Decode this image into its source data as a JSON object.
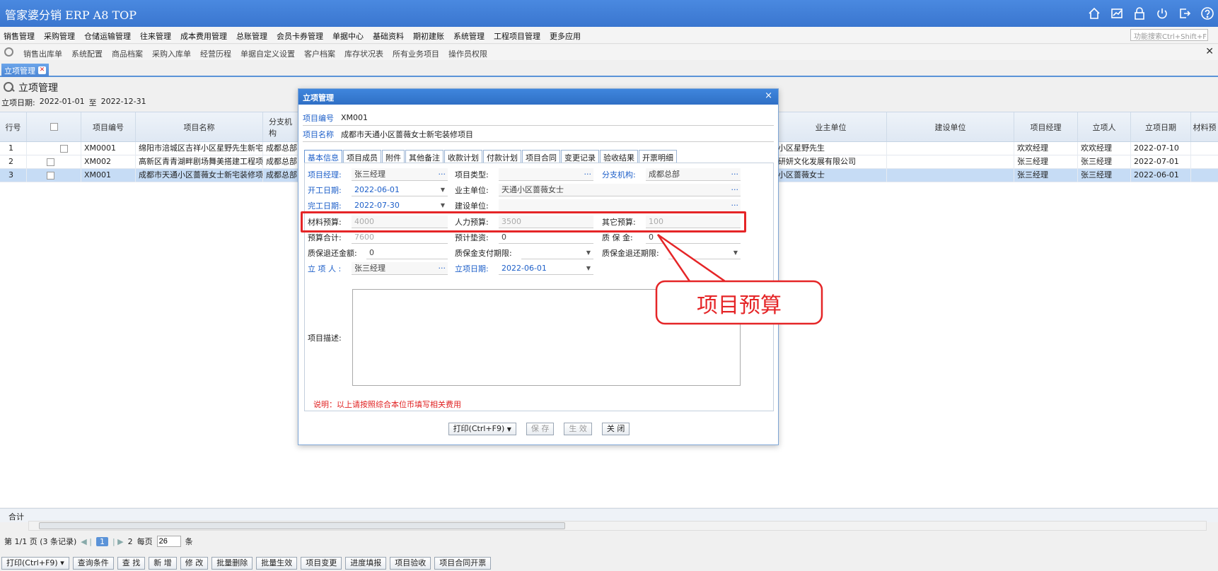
{
  "app": {
    "title": "管家婆分销 ERP A8 TOP"
  },
  "titlebar_icons": [
    "home-icon",
    "chart-icon",
    "lock-icon",
    "power-icon",
    "exit-icon",
    "help-icon"
  ],
  "menu": [
    "销售管理",
    "采购管理",
    "仓储运输管理",
    "往来管理",
    "成本费用管理",
    "总账管理",
    "会员卡券管理",
    "单据中心",
    "基础资料",
    "期初建账",
    "系统管理",
    "工程项目管理",
    "更多应用"
  ],
  "menu_search_placeholder": "功能搜索Ctrl+Shift+F",
  "quickbar": [
    "销售出库单",
    "系统配置",
    "商品档案",
    "采购入库单",
    "经营历程",
    "单据自定义设置",
    "客户档案",
    "库存状况表",
    "所有业务项目",
    "操作员权限"
  ],
  "tab": {
    "label": "立项管理"
  },
  "page": {
    "title": "立项管理",
    "date_label": "立项日期:",
    "date_from": "2022-01-01",
    "date_to_word": "至",
    "date_to": "2022-12-31"
  },
  "grid": {
    "headers": {
      "rowno": "行号",
      "code": "项目编号",
      "name": "项目名称",
      "branch": "分支机构",
      "owner": "业主单位",
      "builder": "建设单位",
      "manager": "项目经理",
      "creator": "立项人",
      "date": "立项日期",
      "material": "材料预"
    },
    "rows": [
      {
        "rowno": "1",
        "code": "XM0001",
        "name": "绵阳市涪城区吉祥小区星野先生新宅装修项目",
        "branch": "成都总部",
        "owner": "小区星野先生",
        "builder": "",
        "manager": "欢欢经理",
        "creator": "欢欢经理",
        "date": "2022-07-10"
      },
      {
        "rowno": "2",
        "code": "XM002",
        "name": "高新区青青湖畔剧场舞美搭建工程项目",
        "branch": "成都总部",
        "owner": "研妍文化发展有限公司",
        "builder": "",
        "manager": "张三经理",
        "creator": "张三经理",
        "date": "2022-07-01"
      },
      {
        "rowno": "3",
        "code": "XM001",
        "name": "成都市天通小区蔷薇女士新宅装修项目",
        "branch": "成都总部",
        "owner": "小区蔷薇女士",
        "builder": "",
        "manager": "张三经理",
        "creator": "张三经理",
        "date": "2022-06-01"
      }
    ],
    "footer_sum": "合计"
  },
  "pager": {
    "info": "第 1/1 页 (3 条记录)",
    "current": "1",
    "next_page": "2",
    "per_page_label": "每页",
    "per_page": "26",
    "unit": "条"
  },
  "bottom_buttons": [
    "打印(Ctrl+F9) ▾",
    "查询条件",
    "查 找",
    "新 增",
    "修 改",
    "批量删除",
    "批量生效",
    "项目变更",
    "进度填报",
    "项目验收",
    "项目合同开票"
  ],
  "dialog": {
    "title": "立项管理",
    "code_label": "项目编号",
    "code": "XM001",
    "name_label": "项目名称",
    "name": "成都市天通小区蔷薇女士新宅装修项目",
    "tabs": [
      "基本信息",
      "项目成员",
      "附件",
      "其他备注",
      "收款计划",
      "付款计划",
      "项目合同",
      "变更记录",
      "验收结果",
      "开票明细"
    ],
    "fields": {
      "manager_label": "项目经理:",
      "manager": "张三经理",
      "type_label": "项目类型:",
      "type": "",
      "branch_label": "分支机构:",
      "branch": "成都总部",
      "start_label": "开工日期:",
      "start": "2022-06-01",
      "owner_label": "业主单位:",
      "owner": "天通小区蔷薇女士",
      "end_label": "完工日期:",
      "end": "2022-07-30",
      "builder_label": "建设单位:",
      "builder": "",
      "material_label": "材料预算:",
      "material": "4000",
      "labor_label": "人力预算:",
      "labor": "3500",
      "other_label": "其它预算:",
      "other": "100",
      "total_label": "预算合计:",
      "total": "7600",
      "advance_label": "预计垫资:",
      "advance": "0",
      "deposit_label": "质 保 金:",
      "deposit": "0",
      "refund_label": "质保退还金额:",
      "refund": "0",
      "paydue_label": "质保金支付期限:",
      "paydue": "",
      "refunddue_label": "质保金退还期限:",
      "refunddue": "",
      "creator_label": "立 项 人 :",
      "creator": "张三经理",
      "cdate_label": "立项日期:",
      "cdate": "2022-06-01",
      "desc_label": "项目描述:"
    },
    "note": "说明：以上请按照综合本位币填写相关费用",
    "buttons": {
      "print": "打印(Ctrl+F9)",
      "save": "保 存",
      "activate": "生 效",
      "close": "关 闭"
    }
  },
  "callout": {
    "text": "项目预算",
    "color": "#e52527"
  }
}
